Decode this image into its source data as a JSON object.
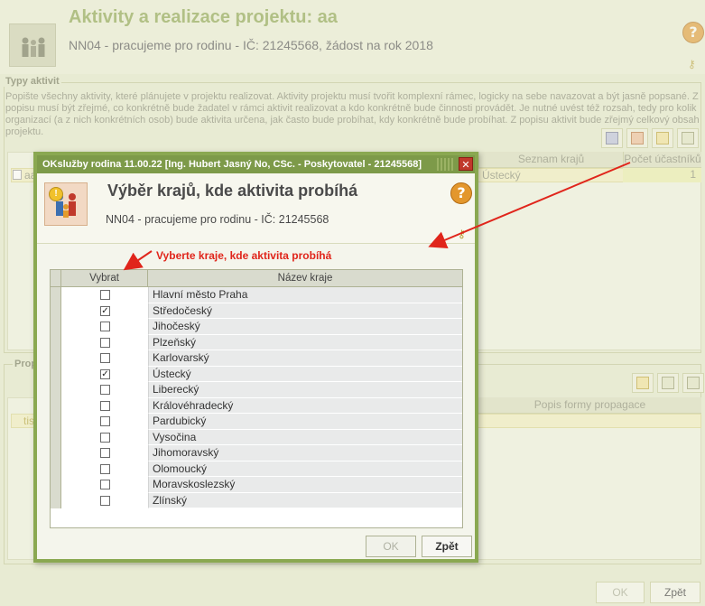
{
  "background": {
    "title": "Aktivity a realizace projektu: aa",
    "subtitle": "NN04 - pracujeme pro rodinu - IČ: 21245568, žádost na rok 2018",
    "section_activities": {
      "legend": "Typy aktivit",
      "description": "Popište všechny aktivity, které plánujete v projektu realizovat. Aktivity projektu musí tvořit komplexní rámec, logicky na sebe navazovat a být jasně popsané. Z popisu musí být zřejmé, co konkrétně bude žadatel v rámci aktivit realizovat a kdo konkrétně bude činnosti provádět. Je nutné uvést též rozsah, tedy pro kolik organizací (a z nich konkrétních osob) bude aktivita určena, jak často bude probíhat, kdy konkrétně bude probíhat. Z popisu aktivit bude zřejmý celkový obsah projektu.",
      "columns": [
        "Seznam krajů",
        "Počet účastníků"
      ],
      "row": {
        "name_fragment": "aa",
        "regions": "Ústecký",
        "participants": "1"
      }
    },
    "section_propagation": {
      "legend_fragment": "Prop",
      "column": "Popis formy propagace",
      "row_fragment": "tis"
    },
    "buttons": {
      "ok": "OK",
      "back": "Zpět"
    }
  },
  "modal": {
    "window_title": "OKslužby rodina 11.00.22  [Ing. Hubert Jasný No, CSc. - Poskytovatel - 21245568]",
    "close_glyph": "✕",
    "title": "Výběr krajů, kde aktivita probíhá",
    "subtitle": "NN04 - pracujeme pro rodinu - IČ: 21245568",
    "hint": "Vyberte kraje, kde aktivita probíhá",
    "table": {
      "headers": {
        "select": "Vybrat",
        "name": "Název kraje"
      },
      "rows": [
        {
          "name": "Hlavní město Praha",
          "checked": false
        },
        {
          "name": "Středočeský",
          "checked": true
        },
        {
          "name": "Jihočeský",
          "checked": false
        },
        {
          "name": "Plzeňský",
          "checked": false
        },
        {
          "name": "Karlovarský",
          "checked": false
        },
        {
          "name": "Ústecký",
          "checked": true
        },
        {
          "name": "Liberecký",
          "checked": false
        },
        {
          "name": "Královéhradecký",
          "checked": false
        },
        {
          "name": "Pardubický",
          "checked": false
        },
        {
          "name": "Vysočina",
          "checked": false
        },
        {
          "name": "Jihomoravský",
          "checked": false
        },
        {
          "name": "Olomoucký",
          "checked": false
        },
        {
          "name": "Moravskoslezský",
          "checked": false
        },
        {
          "name": "Zlínský",
          "checked": false
        }
      ]
    },
    "buttons": {
      "ok": "OK",
      "back": "Zpět"
    }
  },
  "icons": {
    "help": "help-icon",
    "key": "key-icon",
    "close": "close-icon",
    "family": "family-icon"
  },
  "colors": {
    "accent": "#7d9a49",
    "hint_red": "#e0251b",
    "help_orange": "#e3972d"
  }
}
